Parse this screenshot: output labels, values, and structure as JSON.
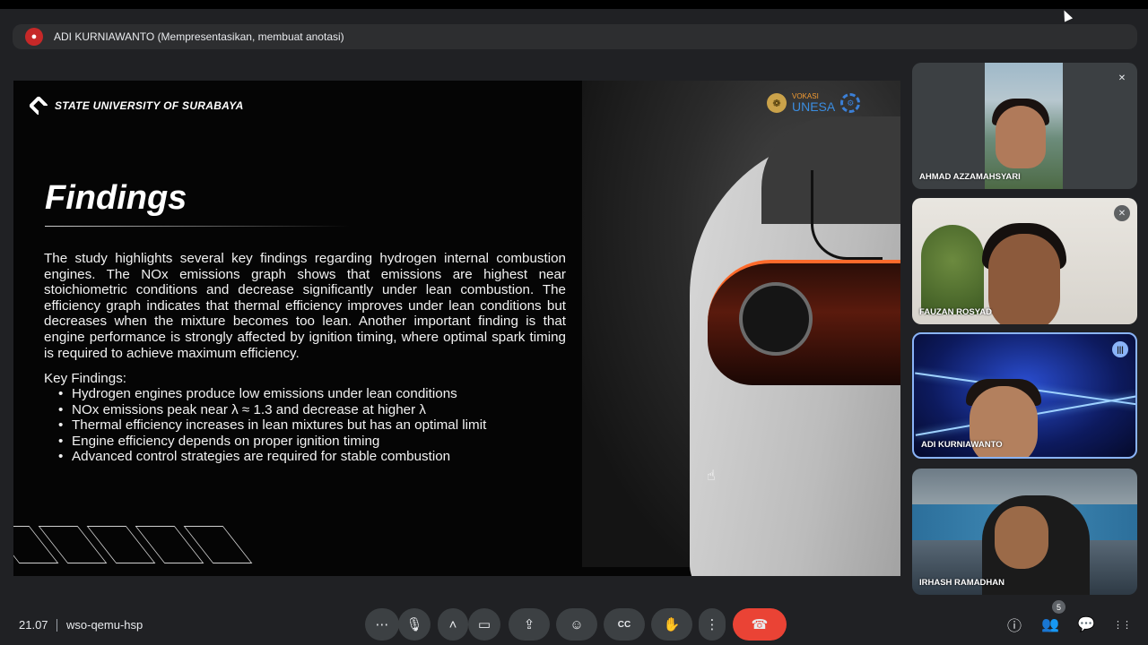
{
  "presenter_bar": {
    "text": "ADI KURNIAWANTO (Mempresentasikan, membuat anotasi)"
  },
  "slide": {
    "brand": "STATE UNIVERSITY OF SURABAYA",
    "logo_vokasi": "VOKASI",
    "logo_unesa": "UNESA",
    "title": "Findings",
    "body": "The study highlights several key findings regarding hydrogen internal combustion engines. The NOx emissions graph shows that emissions are highest near stoichiometric conditions and decrease significantly under lean combustion. The efficiency graph indicates that thermal efficiency improves under lean conditions but decreases when the mixture becomes too lean. Another important finding is that engine performance is strongly affected by ignition timing, where optimal spark timing is required to achieve maximum efficiency.",
    "key_heading": "Key Findings:",
    "key_findings": [
      "Hydrogen engines produce low emissions under lean conditions",
      "NOx emissions peak near λ ≈ 1.3 and decrease at higher λ",
      "Thermal efficiency increases in lean mixtures but has an optimal limit",
      "Engine efficiency depends on proper ignition timing",
      "Advanced control strategies are required for stable combustion"
    ]
  },
  "participants": [
    {
      "name": "AHMAD AZZAMAHSYARI",
      "mic": "muted"
    },
    {
      "name": "FAUZAN ROSYAD",
      "mic": "muted"
    },
    {
      "name": "ADI KURNIAWANTO",
      "mic": "speaking"
    },
    {
      "name": "IRHASH RAMADHAN",
      "mic": "none"
    }
  ],
  "bottom_bar": {
    "time": "21.07",
    "meeting_code": "wso-qemu-hsp",
    "people_count": "5"
  },
  "icons": {
    "more_options_left": "⋯",
    "mic": "🎙",
    "chevron_up": "˄",
    "camera": "▭",
    "present": "⇪",
    "emoji": "☺",
    "captions": "CC",
    "raise_hand": "✋",
    "more_vert": "⋮",
    "end_call": "☎",
    "info": "ⓘ",
    "people": "👥",
    "chat": "💬",
    "activities": "⋮⋮",
    "mic_off": "✕",
    "speaking": "|||"
  },
  "colors": {
    "end_call": "#ea4335",
    "speaking_highlight": "#8ab4f8",
    "background": "#202124"
  }
}
